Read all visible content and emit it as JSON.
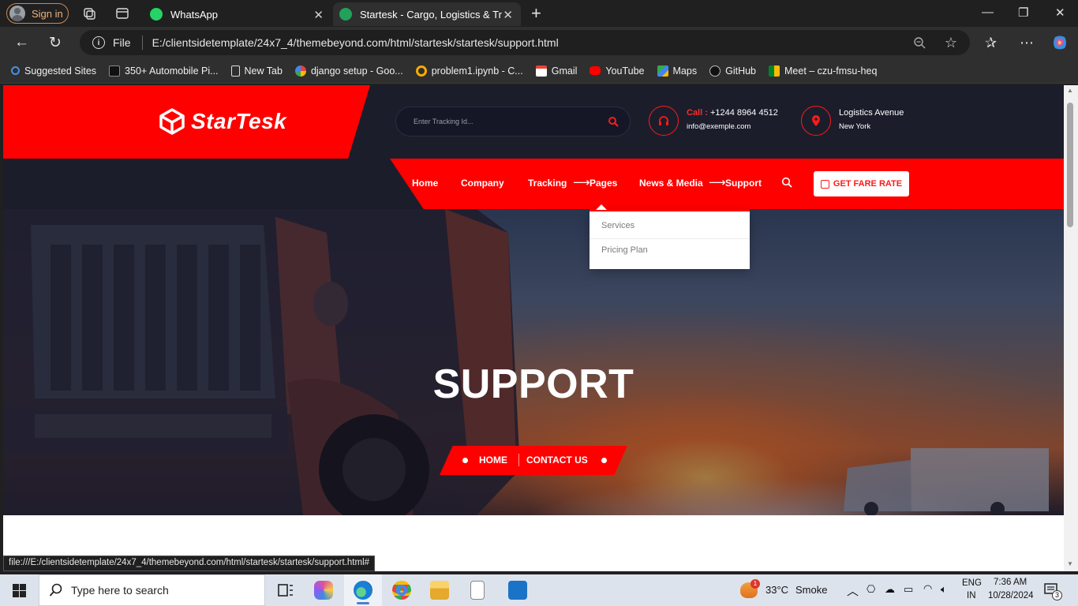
{
  "browser": {
    "signin_label": "Sign in",
    "tabs": [
      {
        "title": "WhatsApp",
        "active": false
      },
      {
        "title": "Startesk - Cargo, Logistics & Transport",
        "active": true
      }
    ],
    "file_label": "File",
    "url": "E:/clientsidetemplate/24x7_4/themebeyond.com/html/startesk/startesk/support.html",
    "bookmarks": [
      {
        "label": "Suggested Sites",
        "icon": "search-icon"
      },
      {
        "label": "350+ Automobile Pi...",
        "icon": "automobile-icon"
      },
      {
        "label": "New Tab",
        "icon": "page-icon"
      },
      {
        "label": "django setup - Goo...",
        "icon": "google-icon"
      },
      {
        "label": "problem1.ipynb - C...",
        "icon": "colab-icon"
      },
      {
        "label": "Gmail",
        "icon": "gmail-icon"
      },
      {
        "label": "YouTube",
        "icon": "youtube-icon"
      },
      {
        "label": "Maps",
        "icon": "maps-icon"
      },
      {
        "label": "GitHub",
        "icon": "github-icon"
      },
      {
        "label": "Meet – czu-fmsu-heq",
        "icon": "meet-icon"
      }
    ],
    "status_url": "file:///E:/clientsidetemplate/24x7_4/themebeyond.com/html/startesk/startesk/support.html#"
  },
  "site": {
    "logo_text": "StarTesk",
    "tracking_placeholder": "Enter Tracking Id...",
    "contact": {
      "call_label": "Call :",
      "phone": "+1244 8964 4512",
      "email": "info@exemple.com"
    },
    "address": {
      "line1": "Logistics Avenue",
      "line2": "New York"
    },
    "nav": {
      "home": "Home",
      "company": "Company",
      "tracking": "Tracking",
      "arrow": "⟶",
      "pages": "Pages",
      "news": "News & Media",
      "support": "Support"
    },
    "fare_button": "GET FARE RATE",
    "dropdown": [
      "Services",
      "Pricing Plan"
    ],
    "breadcrumb": {
      "home": "HOME",
      "current": "CONTACT US"
    },
    "hero_title": "SUPPORT",
    "colors": {
      "brand_red": "#ff0000",
      "header_dark": "#1b1d2b"
    }
  },
  "taskbar": {
    "search_placeholder": "Type here to search",
    "weather": {
      "temp": "33°C",
      "condition": "Smoke",
      "badge": "1"
    },
    "lang": {
      "line1": "ENG",
      "line2": "IN"
    },
    "time": "7:36 AM",
    "date": "10/28/2024",
    "notification_count": "3"
  }
}
